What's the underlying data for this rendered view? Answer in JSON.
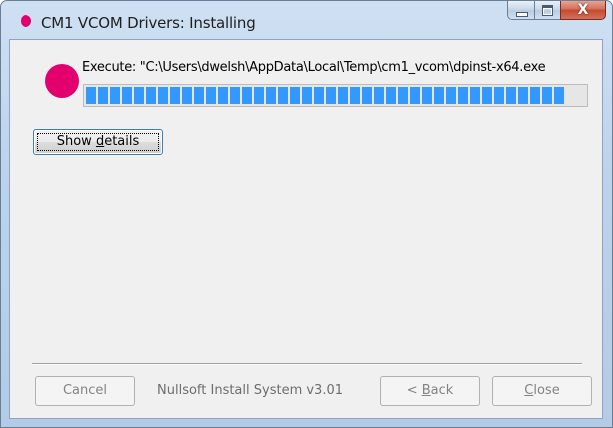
{
  "window": {
    "title": "CM1 VCOM Drivers: Installing",
    "caption_buttons": {
      "minimize": "minimize",
      "maximize": "maximize",
      "close": "X"
    }
  },
  "status": {
    "execute_text": "Execute: \"C:\\Users\\dwelsh\\AppData\\Local\\Temp\\cm1_vcom\\dpinst-x64.exe",
    "progress_fraction": 0.98
  },
  "buttons": {
    "show_details": {
      "prefix": "Show ",
      "accel": "d",
      "suffix": "etails"
    },
    "cancel": "Cancel",
    "back": {
      "prefix": "< ",
      "accel": "B",
      "suffix": "ack"
    },
    "close": {
      "prefix": "",
      "accel": "C",
      "suffix": "lose"
    }
  },
  "branding": "Nullsoft Install System v3.01",
  "colors": {
    "progress_segment": "#3399ff",
    "logo_dark": "#5a5a5a",
    "logo_accent": "#e2006e"
  },
  "icons": {
    "app": "cm1-logo-icon"
  }
}
